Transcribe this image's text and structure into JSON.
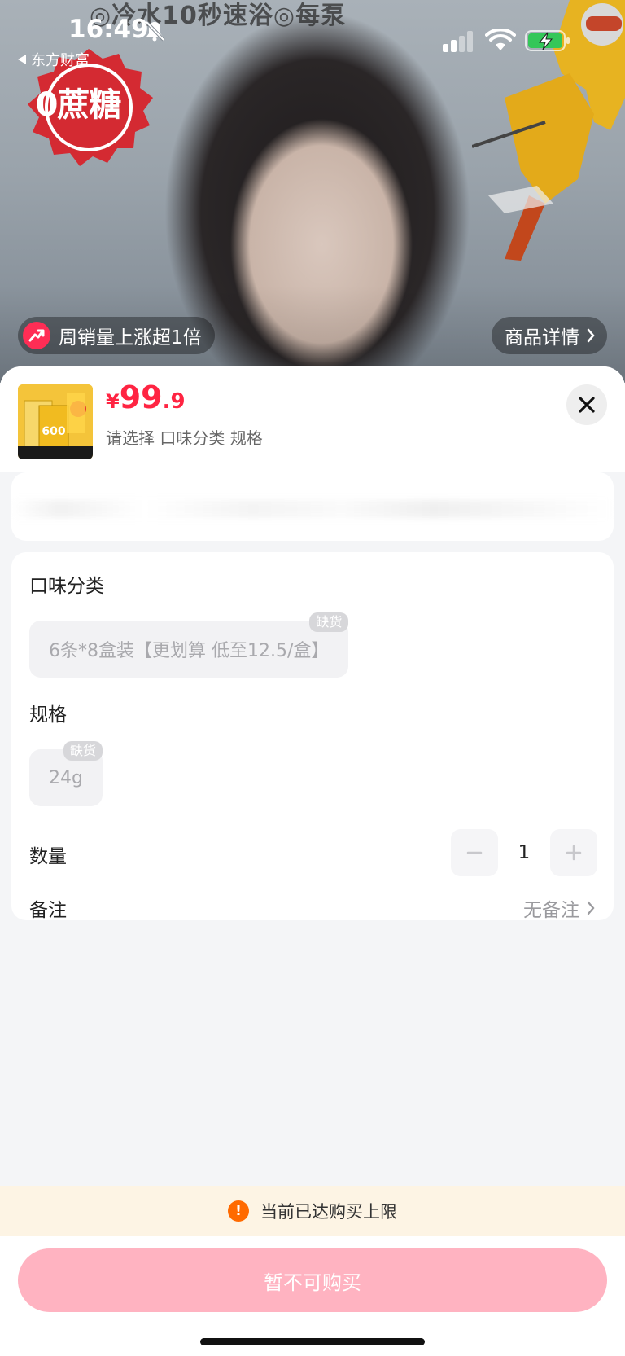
{
  "status_bar": {
    "time": "16:49",
    "back_app": "东方财富"
  },
  "hero": {
    "banner_text": "◎冷水10秒速浴◎每泵",
    "seal_text": "0蔗糖",
    "trend_badge": "周销量上涨超1倍",
    "detail_link": "商品详情"
  },
  "product": {
    "price_currency": "¥",
    "price_int": "99",
    "price_dec": ".9",
    "choose_hint": "请选择 口味分类 规格"
  },
  "options": {
    "flavor_title": "口味分类",
    "flavor_option": "6条*8盒装【更划算 低至12.5/盒】",
    "flavor_stock_tag": "缺货",
    "spec_title": "规格",
    "spec_option": "24g",
    "spec_stock_tag": "缺货",
    "quantity_title": "数量",
    "quantity_value": "1",
    "remark_title": "备注",
    "remark_value": "无备注"
  },
  "limit_notice": "当前已达购买上限",
  "buy_button": "暂不可购买",
  "colors": {
    "price": "#ff2442",
    "buy_button": "#ffb3c1",
    "notice_bg": "#fdf4e4",
    "warning": "#ff6a00"
  }
}
